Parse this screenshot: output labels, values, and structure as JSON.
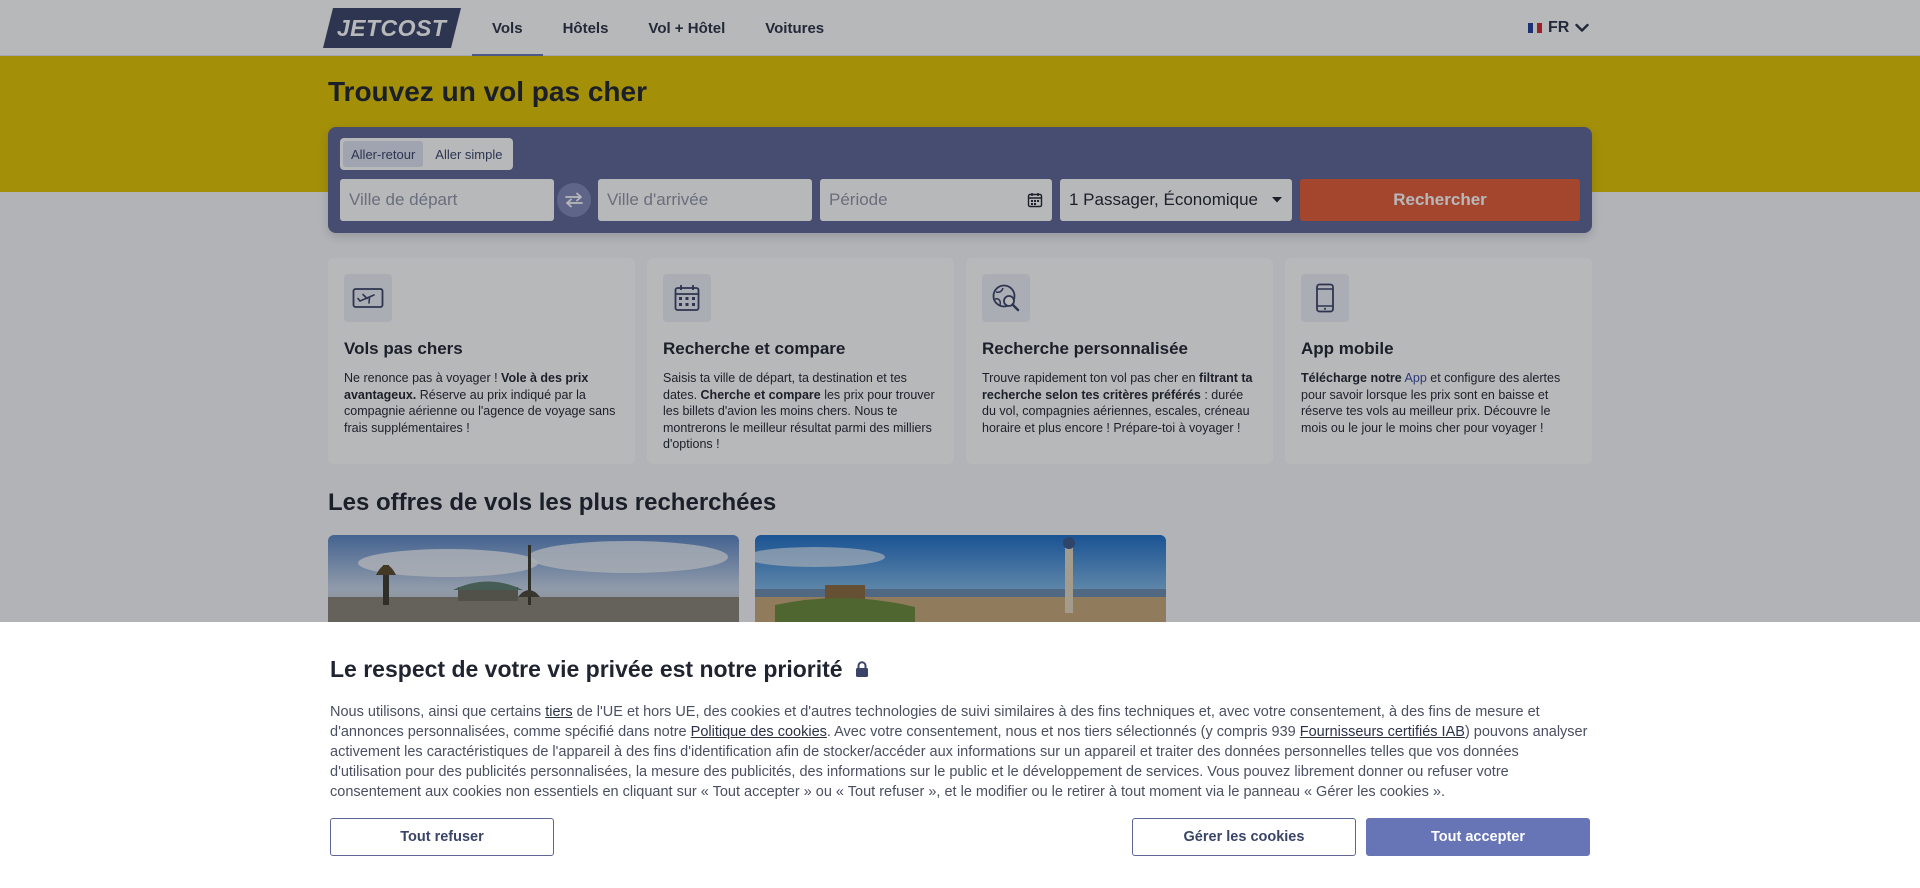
{
  "header": {
    "logo": "JETCOST",
    "nav": [
      {
        "label": "Vols",
        "active": true
      },
      {
        "label": "Hôtels",
        "active": false
      },
      {
        "label": "Vol + Hôtel",
        "active": false
      },
      {
        "label": "Voitures",
        "active": false
      }
    ],
    "language": "FR"
  },
  "hero": {
    "title": "Trouvez un vol pas cher"
  },
  "search": {
    "trip_types": [
      "Aller-retour",
      "Aller simple"
    ],
    "departure_placeholder": "Ville de départ",
    "arrival_placeholder": "Ville d'arrivée",
    "period_placeholder": "Période",
    "passengers": "1 Passager, Économique",
    "submit_label": "Rechercher"
  },
  "features": [
    {
      "icon": "plane-ticket-icon",
      "title": "Vols pas chers",
      "text_1": "Ne renonce pas à voyager ! ",
      "bold_1": "Vole à des prix avantageux.",
      "text_2": " Réserve au prix indiqué par la compagnie aérienne ou l'agence de voyage sans frais supplémentaires !"
    },
    {
      "icon": "calendar-icon",
      "title": "Recherche et compare",
      "text_1": "Saisis ta ville de départ, ta destination et tes dates. ",
      "bold_1": "Cherche et compare",
      "text_2": " les prix pour trouver les billets d'avion les moins chers. Nous te montrerons le meilleur résultat parmi des milliers d'options !"
    },
    {
      "icon": "globe-search-icon",
      "title": "Recherche personnalisée",
      "text_1": "Trouve rapidement ton vol pas cher en ",
      "bold_1": "filtrant ta recherche selon tes critères préférés",
      "text_2": " : durée du vol, compagnies aériennes, escales, créneau horaire et plus encore ! Prépare-toi à voyager !"
    },
    {
      "icon": "smartphone-icon",
      "title": "App mobile",
      "bold_1": "Télécharge notre",
      "link_1": "App",
      "text_2": " et configure des alertes pour savoir lorsque les prix sont en baisse et réserve tes vols au meilleur prix. Découvre le mois ou le jour le moins cher pour voyager !"
    }
  ],
  "offers": {
    "title": "Les offres de vols les plus recherchées"
  },
  "cookie": {
    "title": "Le respect de votre vie privée est notre priorité",
    "p1": "Nous utilisons, ainsi que certains ",
    "link_tiers": "tiers",
    "p2": " de l'UE et hors UE, des cookies et d'autres technologies de suivi similaires à des fins techniques et, avec votre consentement, à des fins de mesure et d'annonces personnalisées, comme spécifié dans notre ",
    "link_policy": "Politique des cookies",
    "p3": ". Avec votre consentement, nous et nos tiers sélectionnés (y compris 939 ",
    "link_iab": "Fournisseurs certifiés IAB",
    "p4": ") pouvons analyser activement les caractéristiques de l'appareil à des fins d'identification afin de stocker/accéder aux informations sur un appareil et traiter des données personnelles telles que vos données d'utilisation pour des publicités personnalisées, la mesure des publicités, des informations sur le public et le développement de services. Vous pouvez librement donner ou refuser votre consentement aux cookies non essentiels en cliquant sur « Tout accepter » ou « Tout refuser », et le modifier ou le retirer à tout moment via le panneau « Gérer les cookies ».",
    "refuse_label": "Tout refuser",
    "manage_label": "Gérer les cookies",
    "accept_label": "Tout accepter"
  },
  "colors": {
    "brand": "#3a4468",
    "hero_yellow": "#e2c500",
    "search_bg": "#5d6697",
    "search_button": "#e45c36",
    "accept_button": "#6774b5"
  }
}
